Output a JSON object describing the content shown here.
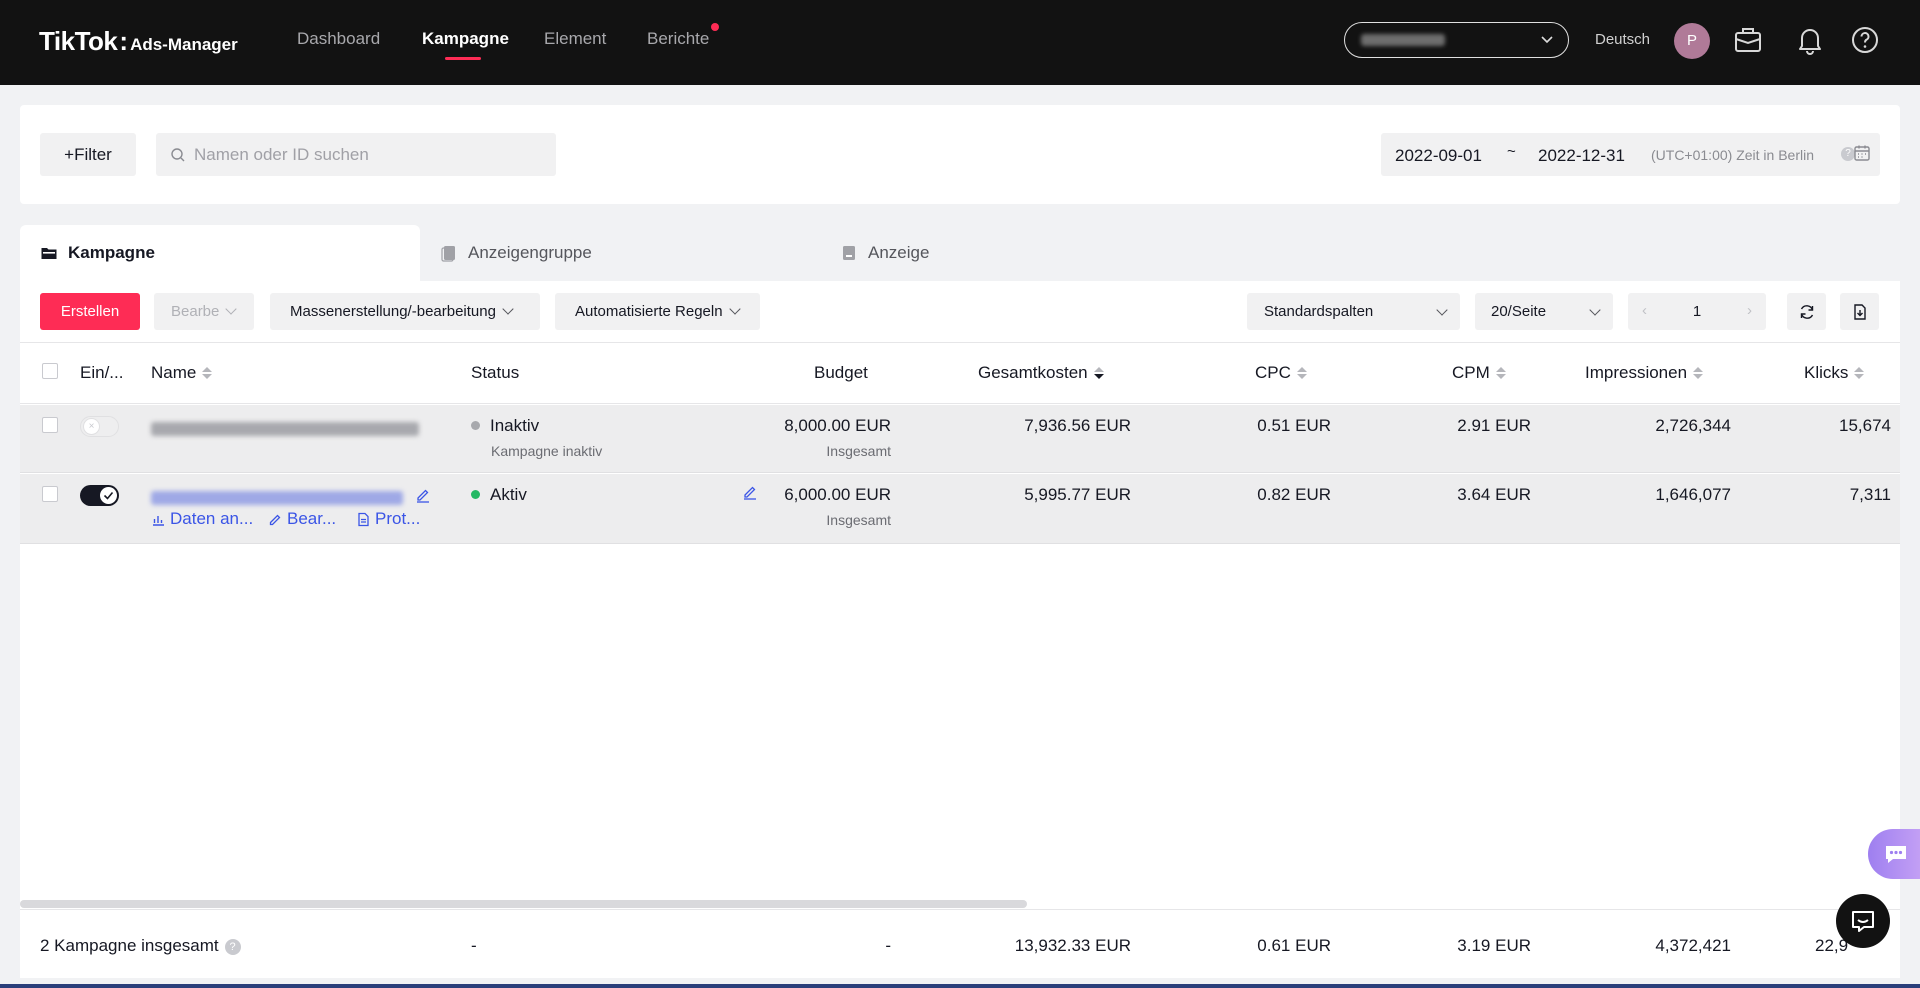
{
  "brand": {
    "logo_main": "TikTok",
    "logo_colon": ":",
    "logo_sub": "Ads-Manager"
  },
  "nav": {
    "items": [
      {
        "label": "Dashboard"
      },
      {
        "label": "Kampagne"
      },
      {
        "label": "Element"
      },
      {
        "label": "Berichte"
      }
    ],
    "active": "Kampagne",
    "language": "Deutsch",
    "avatar_initial": "P"
  },
  "filters": {
    "filter_button": "+Filter",
    "search_placeholder": "Namen oder ID suchen",
    "date_start": "2022-09-01",
    "date_separator": "~",
    "date_end": "2022-12-31",
    "timezone": "(UTC+01:00) Zeit in Berlin"
  },
  "tabs": [
    {
      "label": "Kampagne"
    },
    {
      "label": "Anzeigengruppe"
    },
    {
      "label": "Anzeige"
    }
  ],
  "toolbar": {
    "create": "Erstellen",
    "edit": "Bearbe",
    "bulk": "Massenerstellung/-bearbeitung",
    "rules": "Automatisierte Regeln",
    "columns": "Standardspalten",
    "per_page": "20/Seite",
    "page": "1"
  },
  "table": {
    "headers": {
      "onoff": "Ein/...",
      "name": "Name",
      "status": "Status",
      "budget": "Budget",
      "cost": "Gesamtkosten",
      "cpc": "CPC",
      "cpm": "CPM",
      "impressions": "Impressionen",
      "clicks": "Klicks"
    },
    "rows": [
      {
        "status": "Inaktiv",
        "status_sub": "Kampagne inaktiv",
        "budget": "8,000.00 EUR",
        "budget_sub": "Insgesamt",
        "cost": "7,936.56 EUR",
        "cpc": "0.51 EUR",
        "cpm": "2.91 EUR",
        "impressions": "2,726,344",
        "clicks": "15,674"
      },
      {
        "status": "Aktiv",
        "status_sub": "",
        "budget": "6,000.00 EUR",
        "budget_sub": "Insgesamt",
        "cost": "5,995.77 EUR",
        "cpc": "0.82 EUR",
        "cpm": "3.64 EUR",
        "impressions": "1,646,077",
        "clicks": "7,311",
        "actions": {
          "data": "Daten an...",
          "edit": "Bear...",
          "log": "Prot..."
        }
      }
    ],
    "footer": {
      "label": "2 Kampagne insgesamt",
      "status": "-",
      "budget": "-",
      "cost": "13,932.33 EUR",
      "cpc": "0.61 EUR",
      "cpm": "3.19 EUR",
      "impressions": "4,372,421",
      "clicks": "22,9"
    }
  },
  "colors": {
    "accent": "#fe2c55",
    "topbar": "#121212",
    "link": "#3b55e6",
    "active_status": "#25b864",
    "inactive_status": "#a8a9ad"
  }
}
